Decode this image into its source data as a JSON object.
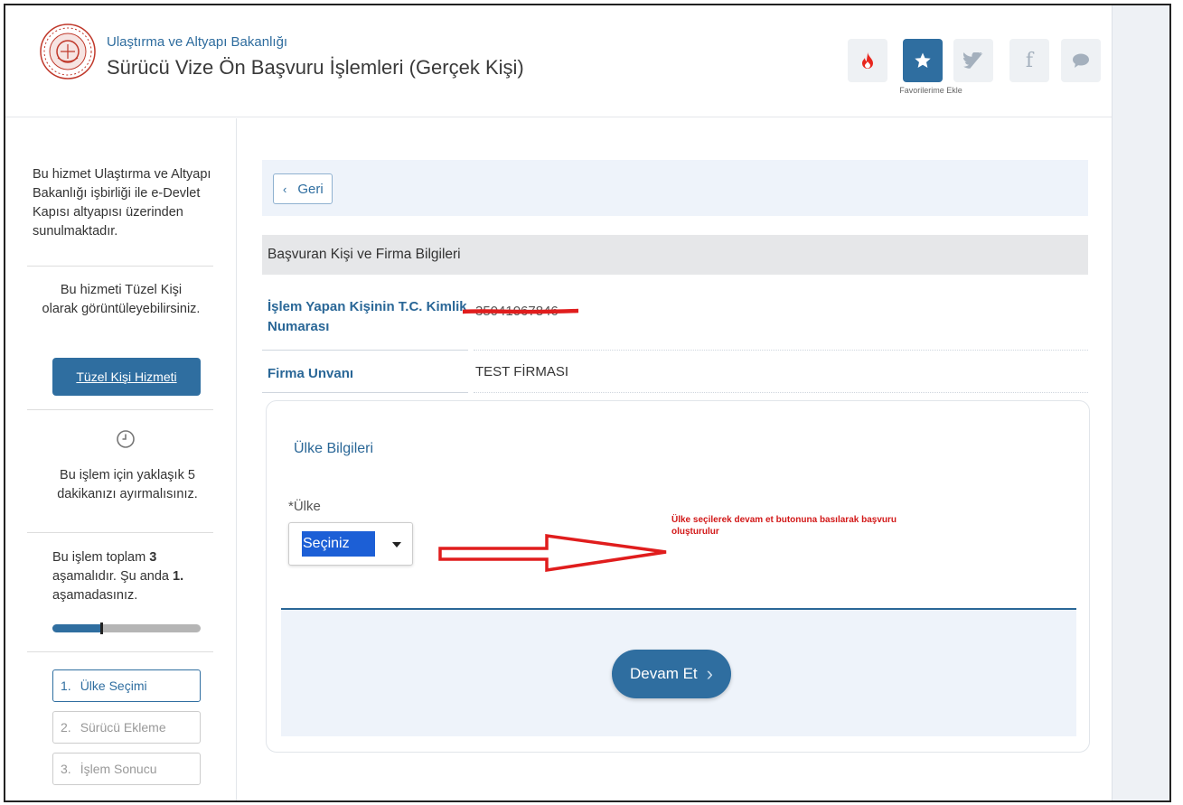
{
  "header": {
    "ministry": "Ulaştırma ve Altyapı Bakanlığı",
    "service_title": "Sürücü Vize Ön Başvuru İşlemleri (Gerçek Kişi)",
    "favorites_label": "Favorilerime Ekle",
    "icons": [
      "flame-icon",
      "star-icon",
      "twitter-icon",
      "facebook-icon",
      "comment-icon"
    ]
  },
  "sidebar": {
    "info": "Bu hizmet Ulaştırma ve Altyapı Bakanlığı işbirliği ile e-Devlet Kapısı altyapısı üzerinden sunulmaktadır.",
    "tuzel_text": "Bu hizmeti Tüzel Kişi olarak görüntüleyebilirsiniz.",
    "tuzel_button": "Tüzel Kişi Hizmeti",
    "time_text": "Bu işlem için yaklaşık 5 dakikanızı ayırmalısınız.",
    "progress_prefix": "Bu işlem toplam ",
    "total_steps": "3",
    "progress_mid": " aşamalıdır. Şu anda ",
    "current_step": "1.",
    "progress_suffix": " aşamadasınız.",
    "progress_fraction": 0.333,
    "steps": [
      {
        "num": "1.",
        "label": "Ülke Seçimi"
      },
      {
        "num": "2.",
        "label": "Sürücü Ekleme"
      },
      {
        "num": "3.",
        "label": "İşlem Sonucu"
      }
    ]
  },
  "main": {
    "back_label": "Geri",
    "section_title": "Başvuran Kişi ve Firma Bilgileri",
    "tc_label": "İşlem Yapan Kişinin T.C. Kimlik Numarası",
    "tc_value": "35041067846",
    "firma_label": "Firma Unvanı",
    "firma_value": "TEST FİRMASI",
    "ulke_section": "Ülke Bilgileri",
    "ulke_label": "*Ülke",
    "ulke_selected": "Seçiniz",
    "annotation": "Ülke seçilerek devam et butonuna basılarak başvuru oluşturulur",
    "devam_label": "Devam Et"
  },
  "colors": {
    "primary": "#2f6ea0",
    "annotation_red": "#d21818",
    "select_highlight": "#1c5fd6"
  }
}
